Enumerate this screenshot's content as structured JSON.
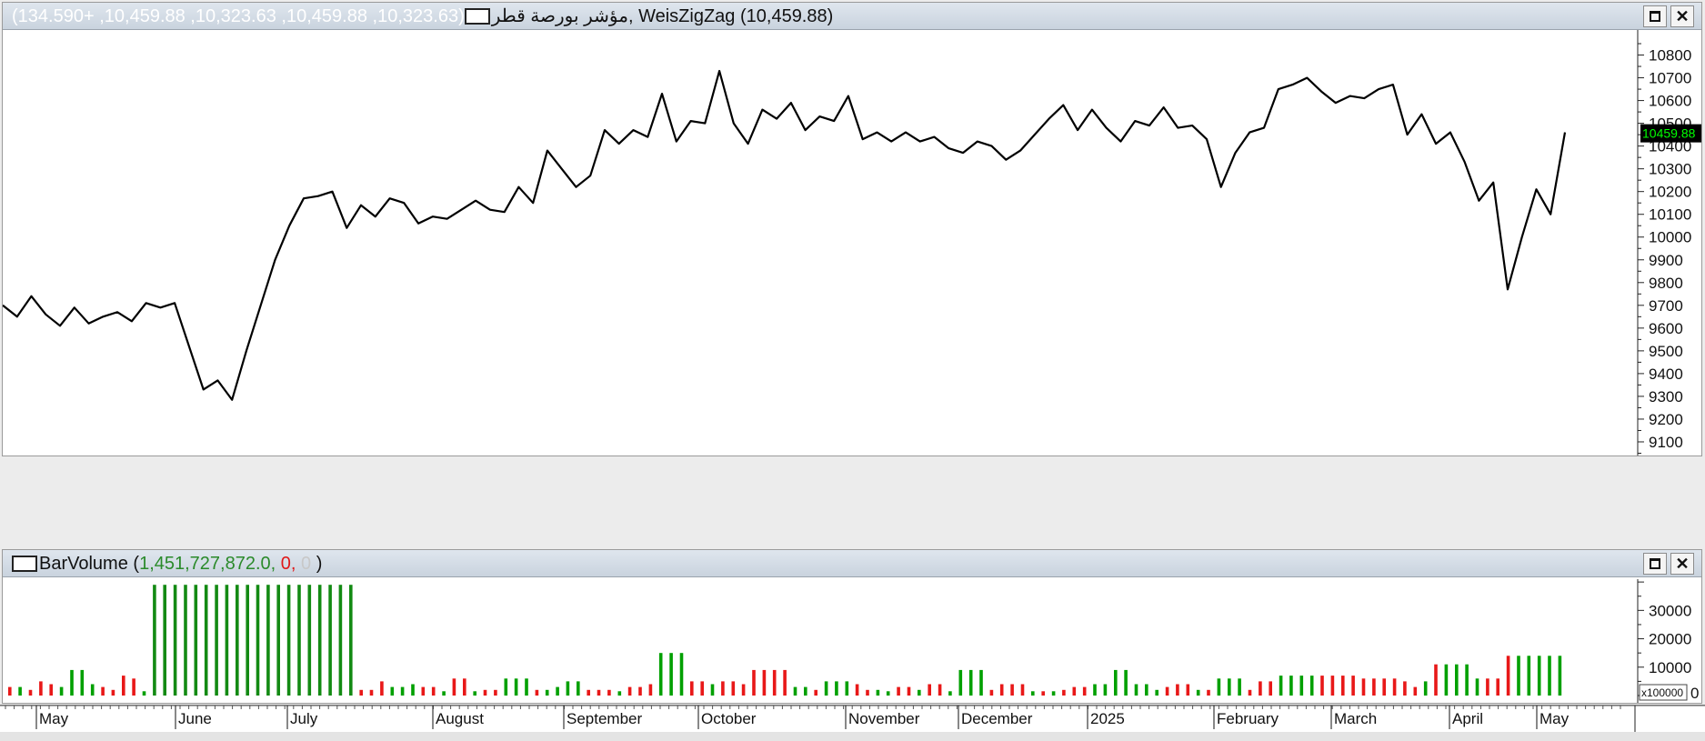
{
  "price_pane": {
    "name": "مؤشر بورصة قطر",
    "ohlc_text": "(10,323.63, 10,459.88, 10,323.63, 10,459.88, +134.590)",
    "separator": ", ",
    "indicator_text": "WeisZigZag (10,459.88)",
    "last_value_label": "10459.88",
    "last_value_color": "#00ff00"
  },
  "volume_pane": {
    "indicator_name": "BarVolume",
    "open_paren": "(",
    "value": "1,451,727,872.0,",
    "second_value": "0,",
    "third_value": "0",
    "close_paren": ")",
    "scale_label": "x100000",
    "zero_label": "0"
  },
  "window_buttons": {
    "restore_icon": "restore-icon",
    "close_label": "✕"
  },
  "x_axis": {
    "month_labels": [
      "May",
      "June",
      "July",
      "August",
      "September",
      "October",
      "November",
      "December",
      "2025",
      "February",
      "March",
      "April",
      "May"
    ]
  },
  "chart_data": [
    {
      "type": "line",
      "title": "",
      "series": [
        {
          "name": "WeisZigZag",
          "color": "#000000",
          "values": [
            9700,
            9650,
            9740,
            9660,
            9610,
            9690,
            9620,
            9650,
            9670,
            9630,
            9710,
            9690,
            9710,
            9520,
            9330,
            9370,
            9285,
            9500,
            9700,
            9900,
            10050,
            10170,
            10180,
            10200,
            10040,
            10140,
            10090,
            10170,
            10150,
            10060,
            10090,
            10080,
            10120,
            10160,
            10120,
            10110,
            10220,
            10150,
            10380,
            10300,
            10220,
            10270,
            10470,
            10410,
            10470,
            10440,
            10630,
            10420,
            10510,
            10500,
            10730,
            10500,
            10410,
            10560,
            10520,
            10590,
            10470,
            10530,
            10510,
            10620,
            10430,
            10460,
            10420,
            10460,
            10420,
            10440,
            10390,
            10370,
            10420,
            10400,
            10340,
            10380,
            10450,
            10520,
            10580,
            10470,
            10560,
            10480,
            10420,
            10510,
            10490,
            10570,
            10480,
            10490,
            10430,
            10220,
            10370,
            10460,
            10480,
            10650,
            10670,
            10700,
            10640,
            10590,
            10620,
            10610,
            10650,
            10670,
            10450,
            10540,
            10410,
            10460,
            10330,
            10160,
            10240,
            9770,
            10000,
            10210,
            10100,
            10460
          ]
        }
      ],
      "ylim": [
        9040,
        10910
      ],
      "y_ticks": [
        9100,
        9200,
        9300,
        9400,
        9500,
        9600,
        9700,
        9800,
        9900,
        10000,
        10100,
        10200,
        10300,
        10400,
        10500,
        10600,
        10700,
        10800
      ],
      "grid": false
    },
    {
      "type": "bar",
      "title": "",
      "units_note": "values in x100000",
      "y_ticks": [
        10000,
        20000,
        30000
      ],
      "ylim": [
        0,
        41000
      ],
      "colors": {
        "up": "#00a000",
        "down": "#e81818",
        "up_dark": "#138a13"
      },
      "values": [
        3000,
        3000,
        2000,
        5000,
        4000,
        3000,
        9000,
        9000,
        4000,
        3000,
        2000,
        7000,
        6000,
        1500,
        39000,
        39000,
        39000,
        39000,
        39000,
        39000,
        39000,
        39000,
        39000,
        39000,
        39000,
        39000,
        39000,
        39000,
        39000,
        39000,
        39000,
        39000,
        39000,
        39000,
        2000,
        2000,
        5000,
        3000,
        3000,
        4000,
        3000,
        3000,
        1500,
        6000,
        6000,
        1500,
        2000,
        2000,
        6000,
        6000,
        6000,
        2000,
        2000,
        3000,
        5000,
        5000,
        2000,
        2000,
        2000,
        1500,
        3000,
        3000,
        4000,
        15000,
        15000,
        15000,
        5000,
        5000,
        4000,
        5000,
        5000,
        4000,
        9000,
        9000,
        9000,
        9000,
        3000,
        3000,
        2000,
        5000,
        5000,
        5000,
        4000,
        2000,
        2000,
        1500,
        3000,
        3000,
        2000,
        4000,
        4000,
        1500,
        9000,
        9000,
        9000,
        2000,
        4000,
        4000,
        4000,
        1500,
        1500,
        1500,
        2000,
        3000,
        3000,
        4000,
        4000,
        9000,
        9000,
        4000,
        4000,
        2000,
        3000,
        4000,
        4000,
        2000,
        2000,
        6000,
        6000,
        6000,
        2000,
        5000,
        5000,
        7000,
        7000,
        7000,
        7000,
        7000,
        7000,
        7000,
        7000,
        6000,
        6000,
        6000,
        6000,
        5000,
        3000,
        5000,
        11000,
        11000,
        11000,
        11000,
        6000,
        6000,
        6000,
        14000,
        14000,
        14000,
        14000,
        14000,
        14000
      ],
      "up": [
        0,
        1,
        0,
        0,
        0,
        1,
        1,
        1,
        1,
        0,
        0,
        0,
        0,
        1,
        1,
        1,
        1,
        1,
        1,
        1,
        1,
        1,
        1,
        1,
        1,
        1,
        1,
        1,
        1,
        1,
        1,
        1,
        1,
        1,
        0,
        0,
        0,
        1,
        1,
        1,
        0,
        0,
        1,
        0,
        0,
        1,
        0,
        0,
        1,
        1,
        1,
        0,
        1,
        1,
        1,
        1,
        0,
        0,
        0,
        1,
        0,
        0,
        0,
        1,
        1,
        1,
        0,
        0,
        1,
        0,
        0,
        0,
        0,
        0,
        0,
        0,
        1,
        1,
        0,
        1,
        1,
        1,
        0,
        0,
        1,
        1,
        0,
        0,
        1,
        0,
        0,
        1,
        1,
        1,
        1,
        0,
        0,
        0,
        0,
        1,
        0,
        1,
        0,
        0,
        0,
        1,
        1,
        1,
        1,
        1,
        1,
        1,
        0,
        0,
        0,
        1,
        0,
        1,
        1,
        1,
        0,
        0,
        0,
        1,
        1,
        1,
        1,
        0,
        0,
        0,
        0,
        0,
        0,
        0,
        0,
        0,
        0,
        1,
        0,
        1,
        1,
        1,
        1,
        0,
        0,
        0,
        1,
        1,
        1,
        1,
        1,
        1
      ]
    }
  ]
}
